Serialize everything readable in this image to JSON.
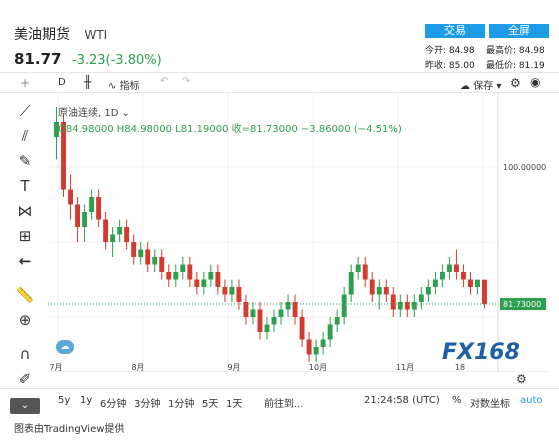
{
  "header": {
    "name": "美油期货",
    "symbol": "WTI",
    "price": "81.77",
    "change": "-3.23(-3.80%)"
  },
  "buttons": {
    "trade": "交易",
    "fullscreen": "全屏"
  },
  "stats": {
    "today_open_label": "今开:",
    "today_open": "84.98",
    "high_label": "最高价:",
    "high": "84.98",
    "prev_close_label": "昨收:",
    "prev_close": "85.00",
    "low_label": "最低价:",
    "low": "81.19"
  },
  "toolbar": {
    "interval": "D",
    "indicators": "指标",
    "save": "保存"
  },
  "legend": {
    "title": "原油连续, 1D",
    "ohlc": "O84.98000  H84.98000  L81.19000  收=81.73000  −3.86000 (−4.51%)"
  },
  "chart_data": {
    "type": "candlestick",
    "y_label_top": "100.00000",
    "last_price_label": "81.73000",
    "x_ticks": [
      "7月",
      "8月",
      "9月",
      "10月",
      "11月",
      "18"
    ],
    "watermark": "FX168",
    "candles": [
      [
        104,
        108,
        101,
        106
      ],
      [
        106,
        107,
        96,
        97
      ],
      [
        97,
        99,
        93,
        95
      ],
      [
        95,
        96,
        90,
        92
      ],
      [
        92,
        95,
        90,
        94
      ],
      [
        94,
        97,
        93,
        96
      ],
      [
        96,
        97,
        92,
        93
      ],
      [
        93,
        94,
        89,
        90
      ],
      [
        90,
        92,
        88,
        91
      ],
      [
        91,
        93,
        90,
        92
      ],
      [
        92,
        93,
        89,
        90
      ],
      [
        90,
        91,
        87,
        88
      ],
      [
        88,
        90,
        87,
        89
      ],
      [
        89,
        90,
        86,
        87
      ],
      [
        87,
        89,
        86,
        88
      ],
      [
        88,
        89,
        85,
        86
      ],
      [
        86,
        87,
        84,
        85
      ],
      [
        85,
        87,
        84,
        86
      ],
      [
        86,
        88,
        85,
        87
      ],
      [
        87,
        88,
        84,
        85
      ],
      [
        85,
        86,
        83,
        84
      ],
      [
        84,
        86,
        83,
        85
      ],
      [
        85,
        87,
        84,
        86
      ],
      [
        86,
        87,
        83,
        84
      ],
      [
        84,
        85,
        82,
        83
      ],
      [
        83,
        85,
        82,
        84
      ],
      [
        84,
        85,
        81,
        82
      ],
      [
        82,
        83,
        79,
        80
      ],
      [
        80,
        82,
        79,
        81
      ],
      [
        81,
        82,
        77,
        78
      ],
      [
        78,
        80,
        77,
        79
      ],
      [
        79,
        81,
        78,
        80
      ],
      [
        80,
        82,
        79,
        81
      ],
      [
        81,
        83,
        80,
        82
      ],
      [
        82,
        83,
        79,
        80
      ],
      [
        80,
        81,
        76,
        77
      ],
      [
        77,
        78,
        74,
        75
      ],
      [
        75,
        77,
        74,
        76
      ],
      [
        76,
        78,
        75,
        77
      ],
      [
        77,
        80,
        76,
        79
      ],
      [
        79,
        81,
        78,
        80
      ],
      [
        80,
        84,
        79,
        83
      ],
      [
        83,
        87,
        82,
        86
      ],
      [
        86,
        88,
        85,
        87
      ],
      [
        87,
        88,
        84,
        85
      ],
      [
        85,
        86,
        82,
        83
      ],
      [
        83,
        85,
        81,
        84
      ],
      [
        84,
        85,
        82,
        83
      ],
      [
        83,
        84,
        80,
        81
      ],
      [
        81,
        83,
        80,
        82
      ],
      [
        82,
        83,
        80,
        81
      ],
      [
        81,
        83,
        80,
        82
      ],
      [
        82,
        84,
        81,
        83
      ],
      [
        83,
        85,
        82,
        84
      ],
      [
        84,
        86,
        83,
        85
      ],
      [
        85,
        87,
        84,
        86
      ],
      [
        86,
        88,
        85,
        87
      ],
      [
        87,
        89,
        85,
        86
      ],
      [
        86,
        87,
        84,
        85
      ],
      [
        85,
        86,
        83,
        84
      ],
      [
        84,
        85,
        83,
        84.98
      ],
      [
        84.98,
        84.98,
        81.19,
        81.73
      ]
    ]
  },
  "bottom": {
    "ranges": [
      "5y",
      "1y",
      "6分钟",
      "3分钟",
      "1分钟",
      "5天",
      "1天"
    ],
    "goto": "前往到...",
    "time": "21:24:58 (UTC)",
    "percent": "%",
    "log": "对数坐标",
    "auto": "auto"
  },
  "footer": "图表由TradingView提供",
  "colors": {
    "up": "#2e9e4f",
    "down": "#d33b2f",
    "accent": "#1e9be6"
  }
}
